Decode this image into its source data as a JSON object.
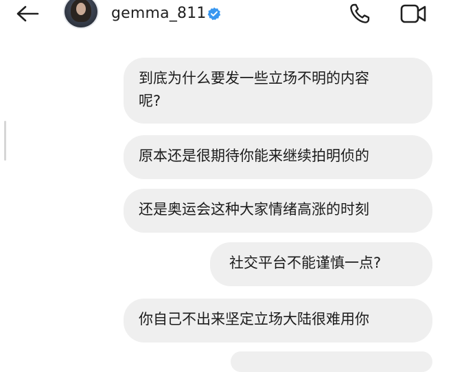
{
  "header": {
    "username": "gemma_811",
    "verified": true,
    "icons": {
      "back": "arrow-left-icon",
      "verified": "verified-badge-icon",
      "call": "phone-icon",
      "video": "video-camera-icon"
    }
  },
  "messages": [
    {
      "text": "到底为什么要发一些立场不明的内容\n呢?"
    },
    {
      "text": "原本还是很期待你能来继续拍明侦的"
    },
    {
      "text": "还是奥运会这种大家情绪高涨的时刻"
    },
    {
      "text": "社交平台不能谨慎一点?"
    },
    {
      "text": "你自己不出来坚定立场大陆很难用你"
    }
  ],
  "colors": {
    "bubble": "#efefef",
    "verified": "#3897f0",
    "text": "#1b1b1b"
  }
}
